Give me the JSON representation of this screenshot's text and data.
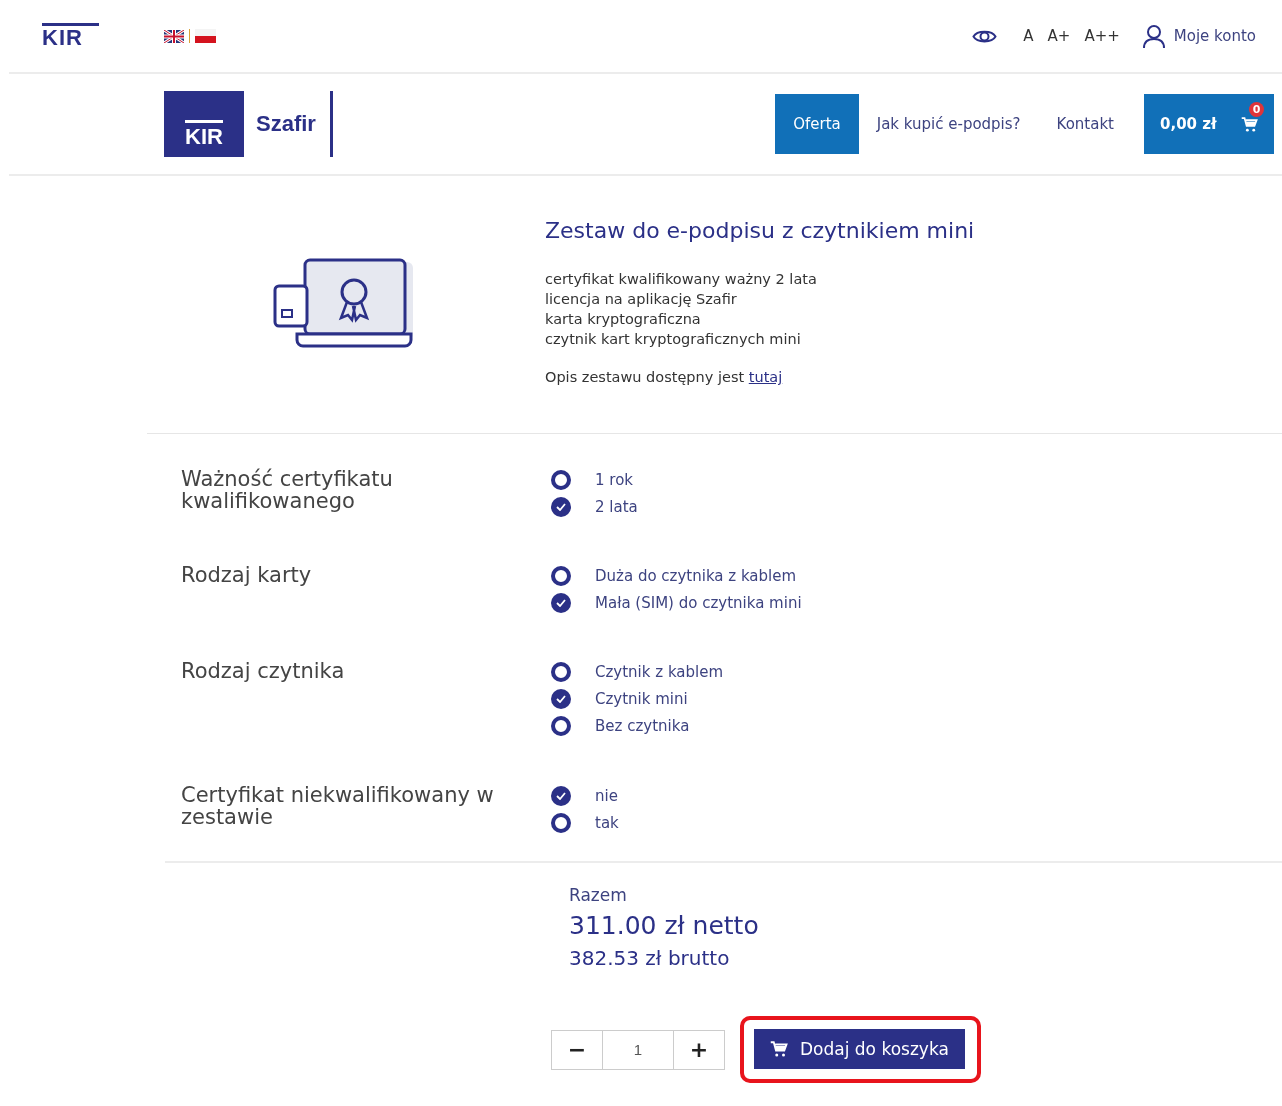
{
  "top_bar": {
    "logo": "KIR",
    "font_sizes": [
      "A",
      "A+",
      "A++"
    ],
    "account": "Moje konto"
  },
  "nav": {
    "logo_box": "KIR",
    "logo_name": "Szafir",
    "items": [
      {
        "label": "Oferta",
        "selected": true
      },
      {
        "label": "Jak kupić e-podpis?",
        "selected": false
      },
      {
        "label": "Kontakt",
        "selected": false
      }
    ],
    "cart": {
      "total": "0,00 zł",
      "count": "0"
    }
  },
  "product": {
    "title": "Zestaw do e-podpisu z czytnikiem mini",
    "features": [
      "certyfikat kwalifikowany ważny 2 lata",
      "licencja na aplikację Szafir",
      "karta kryptograficzna",
      "czytnik kart kryptograficznych mini"
    ],
    "description": "Opis zestawu dostępny jest",
    "link": "tutaj"
  },
  "options": [
    {
      "label": "Ważność certyfikatu kwalifikowanego",
      "choices": [
        {
          "label": "1 rok",
          "selected": false
        },
        {
          "label": "2 lata",
          "selected": true
        }
      ]
    },
    {
      "label": "Rodzaj karty",
      "choices": [
        {
          "label": "Duża do czytnika z kablem",
          "selected": false
        },
        {
          "label": "Mała (SIM) do czytnika mini",
          "selected": true
        }
      ]
    },
    {
      "label": "Rodzaj czytnika",
      "choices": [
        {
          "label": "Czytnik z kablem",
          "selected": false
        },
        {
          "label": "Czytnik mini",
          "selected": true
        },
        {
          "label": "Bez czytnika",
          "selected": false
        }
      ]
    },
    {
      "label": "Certyfikat niekwalifikowany w zestawie",
      "choices": [
        {
          "label": "nie",
          "selected": true
        },
        {
          "label": "tak",
          "selected": false
        }
      ]
    }
  ],
  "summary": {
    "label": "Razem",
    "net": "311.00 zł netto",
    "gross": "382.53 zł brutto"
  },
  "quantity": {
    "minus": "−",
    "value": "1",
    "plus": "+"
  },
  "add_to_cart": {
    "label": "Dodaj do koszyka",
    "highlighted": true
  }
}
